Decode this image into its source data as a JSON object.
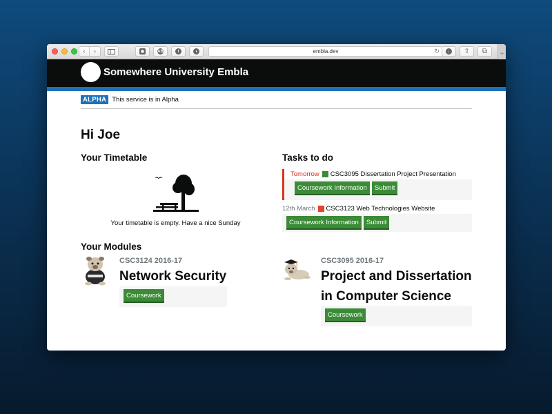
{
  "browser": {
    "url": "embla.dev",
    "nav_back_icon": "chevron-left-icon",
    "nav_forward_icon": "chevron-right-icon"
  },
  "header": {
    "site_title": "Somewhere University Embla"
  },
  "phase_banner": {
    "tag": "ALPHA",
    "text": "This service is in Alpha"
  },
  "greeting": "Hi Joe",
  "timetable": {
    "heading": "Your Timetable",
    "empty_message": "Your timetable is empty. Have a nice Sunday"
  },
  "tasks": {
    "heading": "Tasks to do",
    "items": [
      {
        "due": "Tomorrow",
        "module_color": "#3b8b37",
        "title": "CSC3095 Dissertation Project Presentation",
        "info_label": "Coursework Information",
        "submit_label": "Submit"
      },
      {
        "due": "12th March",
        "module_color": "#e8422e",
        "title": "CSC3123 Web Technologies Website",
        "info_label": "Coursework Information",
        "submit_label": "Submit"
      }
    ]
  },
  "modules": {
    "heading": "Your Modules",
    "items": [
      {
        "code": "CSC3124 2016-17",
        "name": "Network Security",
        "button_label": "Coursework"
      },
      {
        "code": "CSC3095 2016-17",
        "name": "Project and Dissertation in Computer Science",
        "button_label": "Coursework"
      }
    ]
  },
  "colors": {
    "brand_blue": "#1e72b8",
    "button_green": "#3b8b37",
    "urgent_red": "#d4351c"
  }
}
